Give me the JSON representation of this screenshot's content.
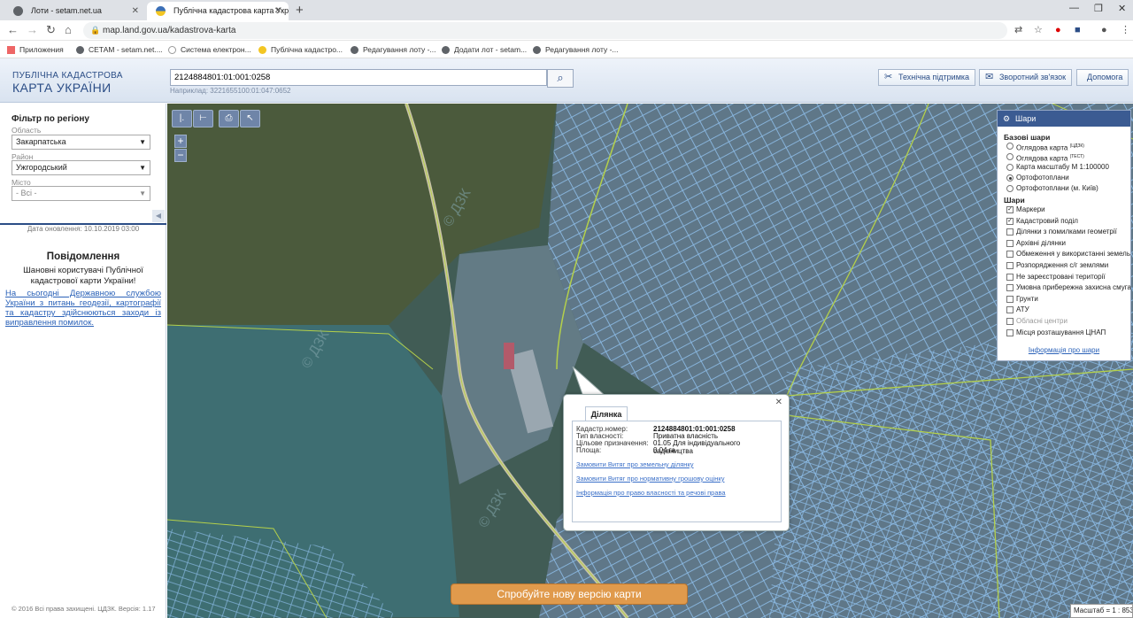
{
  "browser": {
    "tabs": [
      {
        "title": "Лоти - setam.net.ua",
        "favicon_color": "#5f6368"
      },
      {
        "title": "Публічна кадастрова карта Укр",
        "favicon_color": "#3b6fb6"
      }
    ],
    "url": "map.land.gov.ua/kadastrova-karta",
    "bookmarks": [
      "Приложения",
      "СЕТАМ - setam.net....",
      "Система електрон...",
      "Публічна кадастро...",
      "Редагування лоту -...",
      "Додати лот - setam...",
      "Редагування лоту -..."
    ]
  },
  "header": {
    "brand_line1": "ПУБЛІЧНА КАДАСТРОВА",
    "brand_line2": "КАРТА УКРАЇНИ",
    "search_value": "2124884801:01:001:0258",
    "search_hint": "Наприклад: 3221655100:01:047:0652",
    "buttons": {
      "support": "Технічна підтримка",
      "feedback": "Зворотний зв'язок",
      "help": "Допомога"
    }
  },
  "sidebar": {
    "filter_title": "Фільтр по регіону",
    "fields": {
      "oblast_label": "Область",
      "oblast_value": "Закарпатська",
      "raion_label": "Район",
      "raion_value": "Ужгородський",
      "misto_label": "Місто",
      "misto_value": "- Всі -"
    },
    "updated": "Дата оновлення: 10.10.2019 03:00",
    "notif_title": "Повідомлення",
    "notif_text": "Шановні користувачі Публічної кадастрової карти України!",
    "notif_link": "На сьогодні Державною службою України з питань геодезії, картографії та кадастру здійснюються заходи із виправлення помилок.",
    "copyright": "© 2016 Всі права захищені. ЦДЗК. Версія: 1.17"
  },
  "layers": {
    "title": "Шари",
    "base_title": "Базові шари",
    "base": [
      {
        "label": "Оглядова карта",
        "sup": "(ЦДЗК)",
        "selected": false
      },
      {
        "label": "Оглядова карта",
        "sup": "(ТЕСТ)",
        "selected": false
      },
      {
        "label": "Карта масштабу М 1:100000",
        "sup": "",
        "selected": false
      },
      {
        "label": "Ортофотоплани",
        "sup": "",
        "selected": true
      },
      {
        "label": "Ортофотоплани (м. Київ)",
        "sup": "",
        "selected": false
      }
    ],
    "layers_title": "Шари",
    "items": [
      {
        "label": "Маркери",
        "checked": true,
        "dim": false
      },
      {
        "label": "Кадастровий поділ",
        "checked": true,
        "dim": false
      },
      {
        "label": "Ділянки з помилками геометрії",
        "checked": false,
        "dim": false
      },
      {
        "label": "Архівні ділянки",
        "checked": false,
        "dim": false
      },
      {
        "label": "Обмеження у використанні земель",
        "checked": false,
        "dim": false
      },
      {
        "label": "Розпорядження с/г землями",
        "checked": false,
        "dim": false
      },
      {
        "label": "Не зареєстровані території",
        "checked": false,
        "dim": false
      },
      {
        "label": "Умовна прибережна захисна смуга",
        "checked": false,
        "dim": false
      },
      {
        "label": "Грунти",
        "checked": false,
        "dim": false
      },
      {
        "label": "АТУ",
        "checked": false,
        "dim": false
      },
      {
        "label": "Обласні центри",
        "checked": false,
        "dim": true
      },
      {
        "label": "Місця розташування ЦНАП",
        "checked": false,
        "dim": false
      }
    ],
    "info_link": "Інформація про шари"
  },
  "popup": {
    "tab": "Ділянка",
    "rows": [
      {
        "label": "Кадастр.номер:",
        "value": "2124884801:01:001:0258",
        "bold": true
      },
      {
        "label": "Тип власності:",
        "value": "Приватна власність",
        "bold": false
      },
      {
        "label": "Цільове призначення:",
        "value": "01.05 Для індивідуального садівництва",
        "bold": false
      },
      {
        "label": "Площа:",
        "value": "0.04 га",
        "bold": false
      }
    ],
    "links": [
      "Замовити Витяг про земельну ділянку",
      "Замовити Витяг про нормативну грошову оцінку",
      "Інформація про право власності та речові права"
    ]
  },
  "map": {
    "new_version_button": "Спробуйте нову версію карти",
    "scale": "Масштаб = 1 : 8532",
    "watermark": "© ДЗК"
  }
}
